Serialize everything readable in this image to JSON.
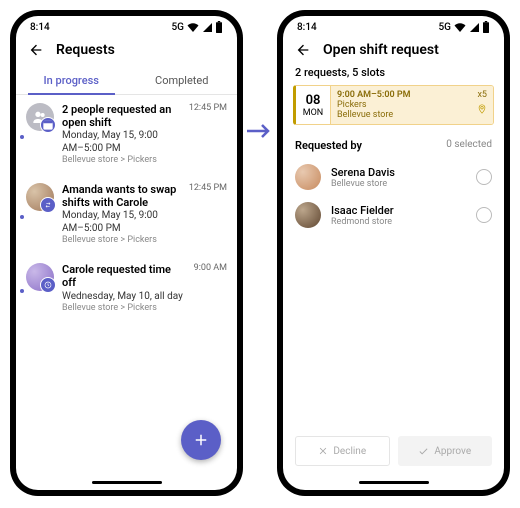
{
  "status": {
    "time": "8:14",
    "net": "5G"
  },
  "left": {
    "title": "Requests",
    "tabs": {
      "progress": "In progress",
      "completed": "Completed"
    },
    "items": [
      {
        "title": "2 people requested an open shift",
        "sub": "Monday, May 15, 9:00 AM–5:00 PM",
        "meta": "Bellevue store > Pickers",
        "time": "12:45 PM"
      },
      {
        "title": "Amanda wants to swap shifts with Carole",
        "sub": "Monday, May 15, 9:00 AM–5:00 PM",
        "meta": "Bellevue store > Pickers",
        "time": "12:45 PM"
      },
      {
        "title": "Carole requested time off",
        "sub": "Wednesday, May 10, all day",
        "meta": "Bellevue store > Pickers",
        "time": "9:00 AM"
      }
    ]
  },
  "right": {
    "title": "Open shift request",
    "summary": "2 requests, 5 slots",
    "date": {
      "day": "08",
      "dow": "MON"
    },
    "shift": {
      "time": "9:00 AM–5:00 PM",
      "role": "Pickers",
      "store": "Bellevue store",
      "count": "x5"
    },
    "req_label": "Requested by",
    "selected": "0 selected",
    "requesters": [
      {
        "name": "Serena Davis",
        "store": "Bellevue store"
      },
      {
        "name": "Isaac Fielder",
        "store": "Redmond store"
      }
    ],
    "decline": "Decline",
    "approve": "Approve"
  }
}
